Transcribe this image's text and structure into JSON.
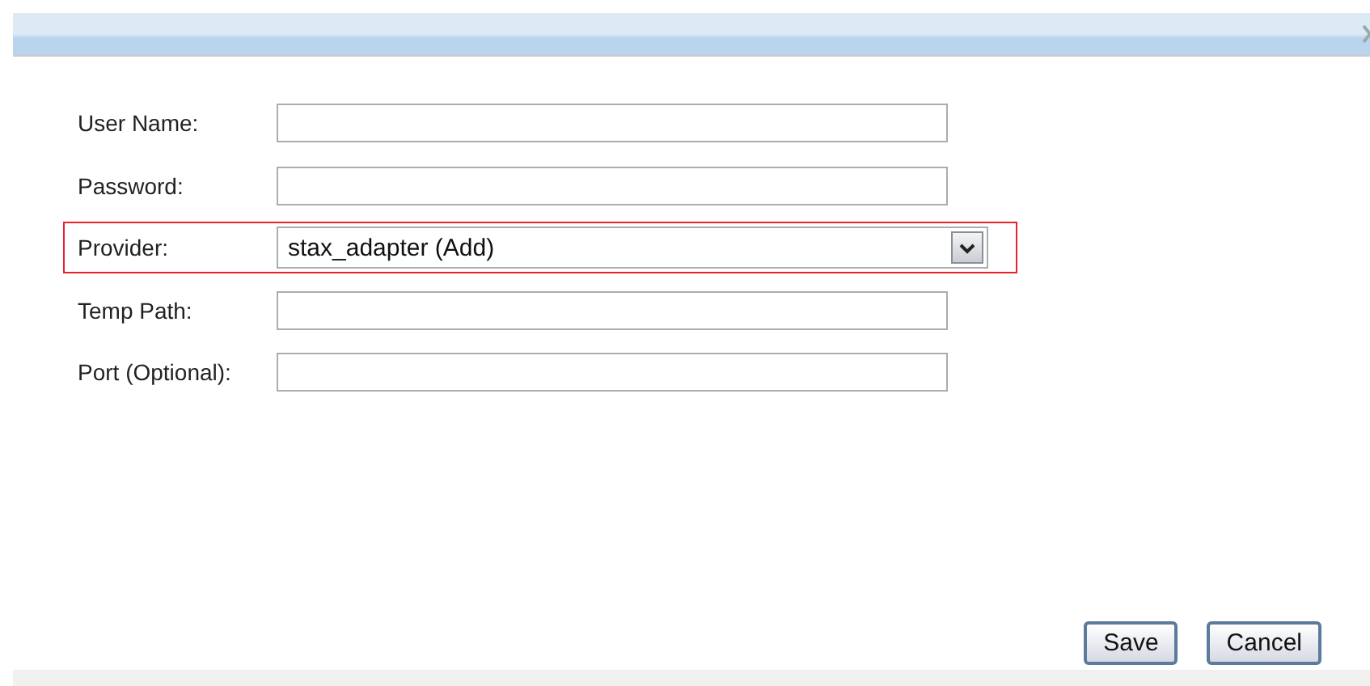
{
  "fields": [
    {
      "label": "User Name:",
      "kind": "text",
      "highlighted": false
    },
    {
      "label": "Password:",
      "kind": "password",
      "highlighted": false
    },
    {
      "label": "Provider:",
      "kind": "select",
      "value": "stax_adapter (Add)",
      "highlighted": true
    },
    {
      "label": "Temp Path:",
      "kind": "text",
      "highlighted": false
    },
    {
      "label": "Port (Optional):",
      "kind": "text",
      "highlighted": false
    }
  ],
  "buttons": [
    "Save",
    "Cancel"
  ]
}
